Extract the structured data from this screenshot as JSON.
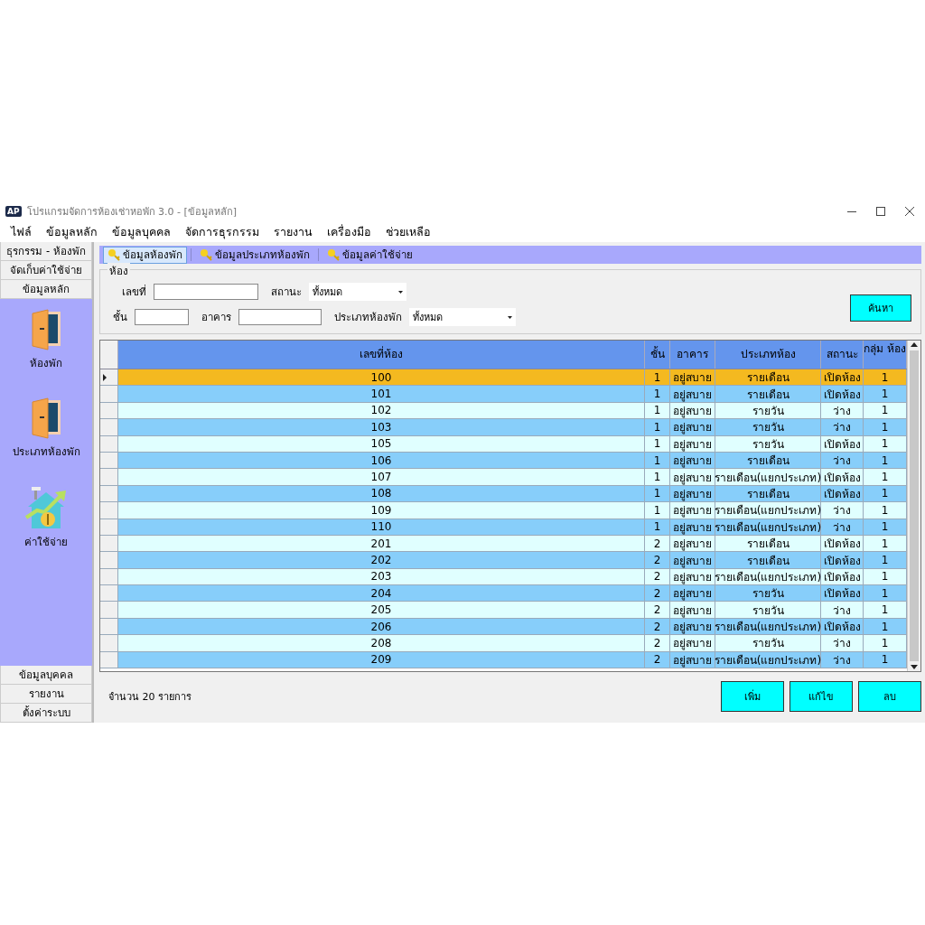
{
  "window": {
    "app_badge": "AP",
    "title": "โปรแกรมจัดการห้องเช่าหอพัก 3.0 - [ข้อมูลหลัก]"
  },
  "menu": [
    "ไฟล์",
    "ข้อมูลหลัก",
    "ข้อมูลบุคคล",
    "จัดการธุรกรรม",
    "รายงาน",
    "เครื่องมือ",
    "ช่วยเหลือ"
  ],
  "sidebar": {
    "top_sections": [
      "ธุรกรรม - ห้องพัก",
      "จัดเก็บค่าใช้จ่าย",
      "ข้อมูลหลัก"
    ],
    "items": [
      {
        "label": "ห้องพัก",
        "kind": "door"
      },
      {
        "label": "ประเภทห้องพัก",
        "kind": "door"
      },
      {
        "label": "ค่าใช้จ่าย",
        "kind": "expense"
      }
    ],
    "bottom_sections": [
      "ข้อมูลบุคคล",
      "รายงาน",
      "ตั้งค่าระบบ"
    ]
  },
  "tabs": [
    {
      "label": "ข้อมูลห้องพัก",
      "selected": true
    },
    {
      "label": "ข้อมูลประเภทห้องพัก",
      "selected": false
    },
    {
      "label": "ข้อมูลค่าใช้จ่าย",
      "selected": false
    }
  ],
  "filter": {
    "title": "ห้อง",
    "rows": [
      [
        {
          "label": "เลขที่",
          "kind": "text"
        },
        {
          "label": "สถานะ",
          "kind": "select",
          "value": "ทั้งหมด"
        }
      ],
      [
        {
          "label": "ชั้น",
          "kind": "text"
        },
        {
          "label": "อาคาร",
          "kind": "text"
        },
        {
          "label": "ประเภทห้องพัก",
          "kind": "select",
          "value": "ทั้งหมด"
        }
      ]
    ],
    "search_button": "ค้นหา"
  },
  "table": {
    "columns": [
      "เลขที่ห้อง",
      "ชั้น",
      "อาคาร",
      "ประเภทห้อง",
      "สถานะ",
      "กลุ่ม ห้อง"
    ],
    "rows": [
      {
        "selected": true,
        "cells": [
          "100",
          "1",
          "อยู่สบาย",
          "รายเดือน",
          "เปิดห้อง",
          "1"
        ]
      },
      {
        "selected": false,
        "cells": [
          "101",
          "1",
          "อยู่สบาย",
          "รายเดือน",
          "เปิดห้อง",
          "1"
        ]
      },
      {
        "selected": false,
        "cells": [
          "102",
          "1",
          "อยู่สบาย",
          "รายวัน",
          "ว่าง",
          "1"
        ]
      },
      {
        "selected": false,
        "cells": [
          "103",
          "1",
          "อยู่สบาย",
          "รายวัน",
          "ว่าง",
          "1"
        ]
      },
      {
        "selected": false,
        "cells": [
          "105",
          "1",
          "อยู่สบาย",
          "รายวัน",
          "เปิดห้อง",
          "1"
        ]
      },
      {
        "selected": false,
        "cells": [
          "106",
          "1",
          "อยู่สบาย",
          "รายเดือน",
          "ว่าง",
          "1"
        ]
      },
      {
        "selected": false,
        "cells": [
          "107",
          "1",
          "อยู่สบาย",
          "รายเดือน(แยกประเภท)",
          "เปิดห้อง",
          "1"
        ]
      },
      {
        "selected": false,
        "cells": [
          "108",
          "1",
          "อยู่สบาย",
          "รายเดือน",
          "เปิดห้อง",
          "1"
        ]
      },
      {
        "selected": false,
        "cells": [
          "109",
          "1",
          "อยู่สบาย",
          "รายเดือน(แยกประเภท)",
          "ว่าง",
          "1"
        ]
      },
      {
        "selected": false,
        "cells": [
          "110",
          "1",
          "อยู่สบาย",
          "รายเดือน(แยกประเภท)",
          "ว่าง",
          "1"
        ]
      },
      {
        "selected": false,
        "cells": [
          "201",
          "2",
          "อยู่สบาย",
          "รายเดือน",
          "เปิดห้อง",
          "1"
        ]
      },
      {
        "selected": false,
        "cells": [
          "202",
          "2",
          "อยู่สบาย",
          "รายเดือน",
          "เปิดห้อง",
          "1"
        ]
      },
      {
        "selected": false,
        "cells": [
          "203",
          "2",
          "อยู่สบาย",
          "รายเดือน(แยกประเภท)",
          "เปิดห้อง",
          "1"
        ]
      },
      {
        "selected": false,
        "cells": [
          "204",
          "2",
          "อยู่สบาย",
          "รายวัน",
          "เปิดห้อง",
          "1"
        ]
      },
      {
        "selected": false,
        "cells": [
          "205",
          "2",
          "อยู่สบาย",
          "รายวัน",
          "ว่าง",
          "1"
        ]
      },
      {
        "selected": false,
        "cells": [
          "206",
          "2",
          "อยู่สบาย",
          "รายเดือน(แยกประเภท)",
          "เปิดห้อง",
          "1"
        ]
      },
      {
        "selected": false,
        "cells": [
          "208",
          "2",
          "อยู่สบาย",
          "รายวัน",
          "ว่าง",
          "1"
        ]
      },
      {
        "selected": false,
        "cells": [
          "209",
          "2",
          "อยู่สบาย",
          "รายเดือน(แยกประเภท)",
          "ว่าง",
          "1"
        ]
      }
    ]
  },
  "footer": {
    "count": "จำนวน 20 รายการ",
    "buttons": [
      "เพิ่ม",
      "แก้ไข",
      "ลบ"
    ]
  }
}
